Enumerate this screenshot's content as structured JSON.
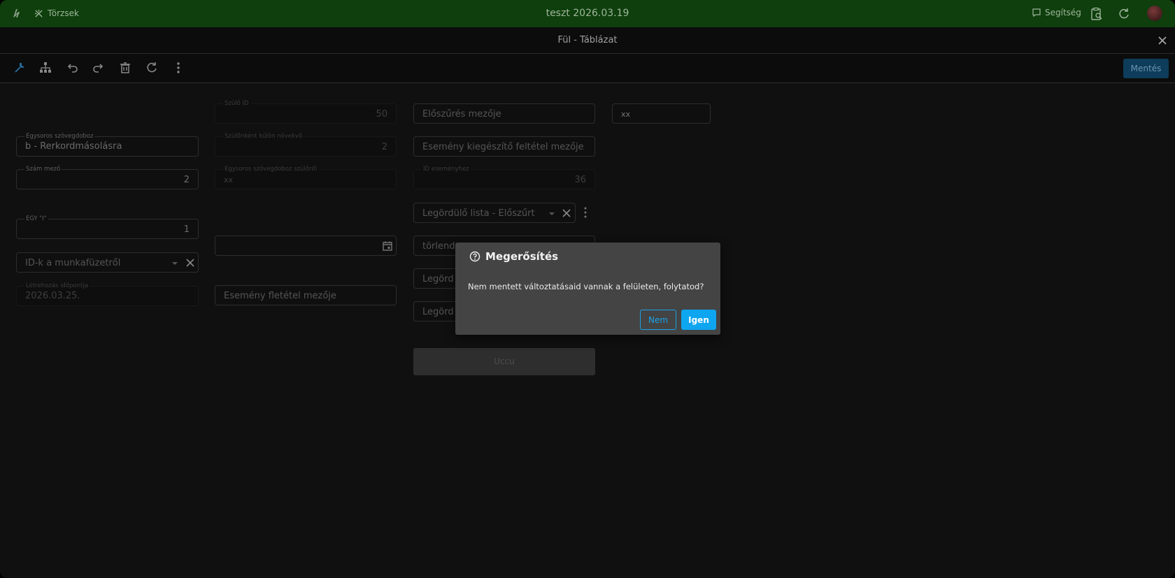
{
  "topbar": {
    "logo_icon": "logo-icon",
    "nav_label": "Törzsek",
    "title": "teszt 2026.03.19",
    "help_label": "Segítség",
    "accent": "#0e3f0c"
  },
  "dialog": {
    "title": "Fül - Táblázat",
    "save_label": "Mentés",
    "save_color": "#0d3d5a"
  },
  "form": {
    "col1": {
      "text_label": "Egysoros szövegdoboz",
      "text_value": "b - Rerkordmásolásra",
      "number_label": "Szám mező",
      "number_value": "2",
      "egy_label": "EGY \"I\"",
      "egy_value": "1",
      "dropdown_placeholder": "ID-k a munkafüzetről",
      "created_label": "Létrehozás időpontja",
      "created_value": "2026.03.25."
    },
    "col2": {
      "parent_id_label": "Szülő ID",
      "parent_id_value": "50",
      "per_parent_label": "Szülőnként külön növekvő",
      "per_parent_value": "2",
      "text_from_parent_label": "Egysoros szövegdoboz szülőről",
      "text_from_parent_value": "xx",
      "event_condition_placeholder": "Esemény fletétel mezője"
    },
    "col3": {
      "prefilter_placeholder": "Előszűrés mezője",
      "event_extra_placeholder": "Esemény kiegészítő feltétel mezője",
      "event_id_label": "ID eseményhez",
      "event_id_value": "36",
      "dropdown_prefiltered": "Legördülő lista - Előszűrt",
      "torlendo_partial": "törlend",
      "legord_partial_1": "Legörd",
      "legord_partial_2": "Legörd",
      "ucu_label": "Uccu"
    },
    "col4": {
      "xx_value": "xx"
    }
  },
  "modal": {
    "title": "Megerősítés",
    "icon": "question-circle-icon",
    "message": "Nem mentett változtatásaid vannak a felületen, folytatod?",
    "no_label": "Nem",
    "yes_label": "Igen",
    "primary_color": "#0ea5f1"
  }
}
